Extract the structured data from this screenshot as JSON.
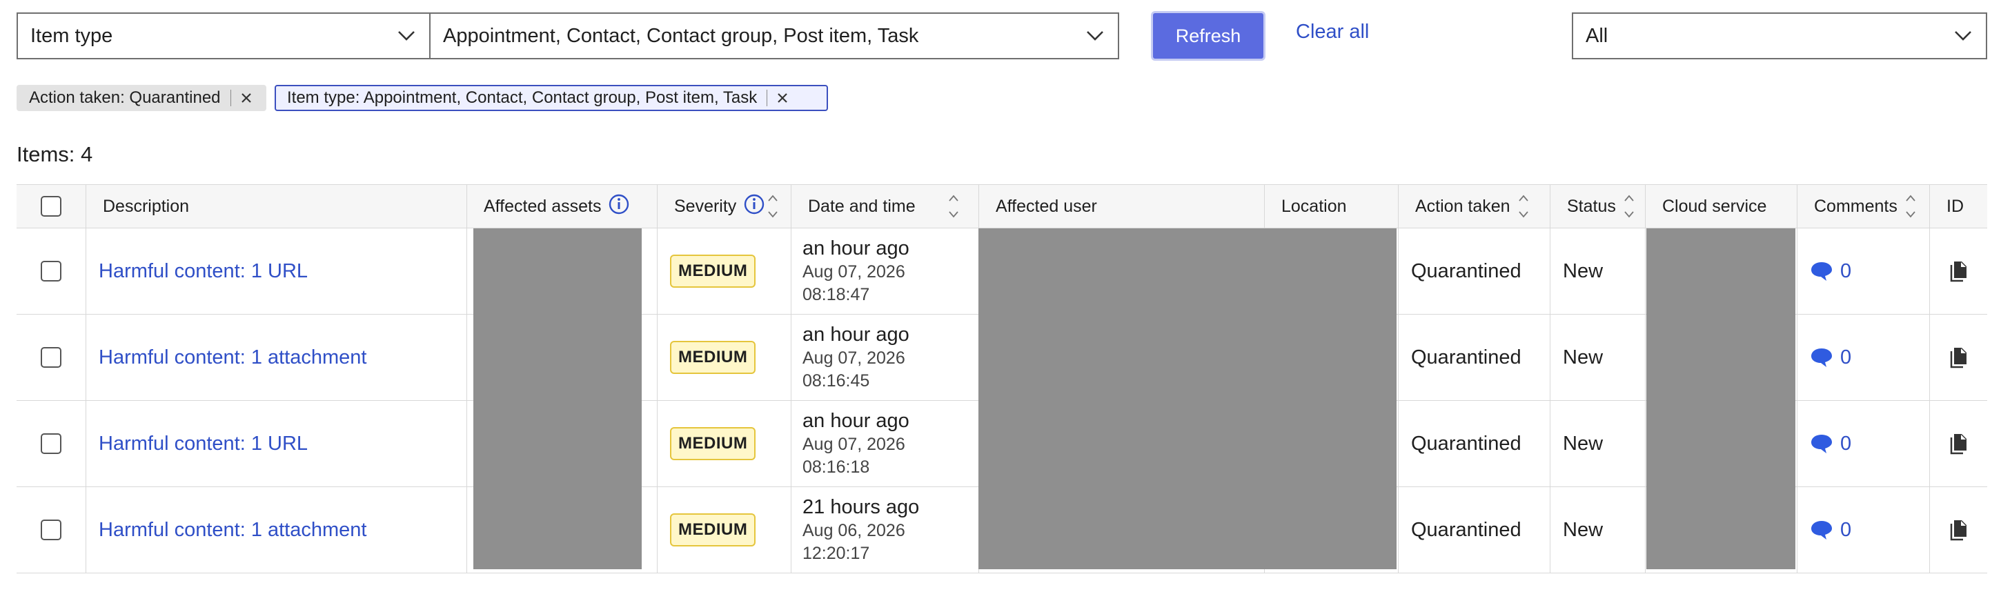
{
  "filters": {
    "field_select": "Item type",
    "value_select": "Appointment, Contact, Contact group, Post item, Task",
    "refresh_label": "Refresh",
    "clear_all_label": "Clear all",
    "scope_select": "All"
  },
  "chips": [
    {
      "label": "Action taken: Quarantined"
    },
    {
      "label": "Item type: Appointment, Contact, Contact group, Post item, Task"
    }
  ],
  "items_count": "Items: 4",
  "columns": {
    "description": "Description",
    "affected_assets": "Affected assets",
    "severity": "Severity",
    "date_time": "Date and time",
    "affected_user": "Affected user",
    "location": "Location",
    "action_taken": "Action taken",
    "status": "Status",
    "cloud_service": "Cloud service",
    "comments": "Comments",
    "id": "ID"
  },
  "rows": [
    {
      "description": "Harmful content: 1 URL",
      "severity": "MEDIUM",
      "relative_time": "an hour ago",
      "date": "Aug 07, 2026",
      "time": "08:18:47",
      "action_taken": "Quarantined",
      "status": "New",
      "comments": "0"
    },
    {
      "description": "Harmful content: 1 attachment",
      "severity": "MEDIUM",
      "relative_time": "an hour ago",
      "date": "Aug 07, 2026",
      "time": "08:16:45",
      "action_taken": "Quarantined",
      "status": "New",
      "comments": "0"
    },
    {
      "description": "Harmful content: 1 URL",
      "severity": "MEDIUM",
      "relative_time": "an hour ago",
      "date": "Aug 07, 2026",
      "time": "08:16:18",
      "action_taken": "Quarantined",
      "status": "New",
      "comments": "0"
    },
    {
      "description": "Harmful content: 1 attachment",
      "severity": "MEDIUM",
      "relative_time": "21 hours ago",
      "date": "Aug 06, 2026",
      "time": "12:20:17",
      "action_taken": "Quarantined",
      "status": "New",
      "comments": "0"
    }
  ],
  "icons": {
    "chevron": "chevron-down-icon",
    "close": "close-icon",
    "info": "info-icon",
    "sort": "sort-icon",
    "comment": "comment-bubble-icon",
    "id": "document-copy-icon"
  },
  "colors": {
    "accent": "#5b6be0",
    "link": "#2f4fc7",
    "badge_bg": "#fff7c9",
    "badge_border": "#e5c53c",
    "redacted": "#8f8f8f"
  }
}
